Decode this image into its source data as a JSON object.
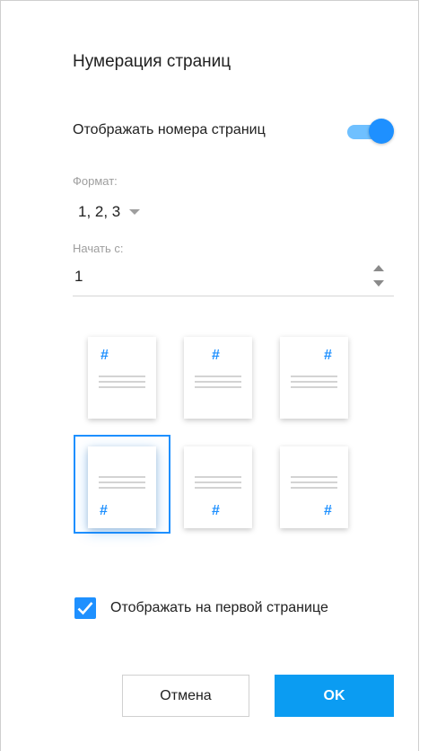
{
  "dialog": {
    "title": "Нумерация страниц",
    "show_numbers_label": "Отображать номера страниц",
    "show_numbers_on": true,
    "format": {
      "label": "Формат:",
      "value": "1, 2, 3"
    },
    "start": {
      "label": "Начать с:",
      "value": "1"
    },
    "positions": [
      {
        "id": "top-left",
        "selected": false
      },
      {
        "id": "top-center",
        "selected": false
      },
      {
        "id": "top-right",
        "selected": false
      },
      {
        "id": "bottom-left",
        "selected": true
      },
      {
        "id": "bottom-center",
        "selected": false
      },
      {
        "id": "bottom-right",
        "selected": false
      }
    ],
    "position_glyph": "#",
    "first_page_label": "Отображать на первой странице",
    "first_page_checked": true,
    "cancel_label": "Отмена",
    "ok_label": "OK"
  },
  "colors": {
    "accent": "#1e90ff",
    "ok_button": "#0b9cf2",
    "toggle_track": "#6fc0ff"
  }
}
